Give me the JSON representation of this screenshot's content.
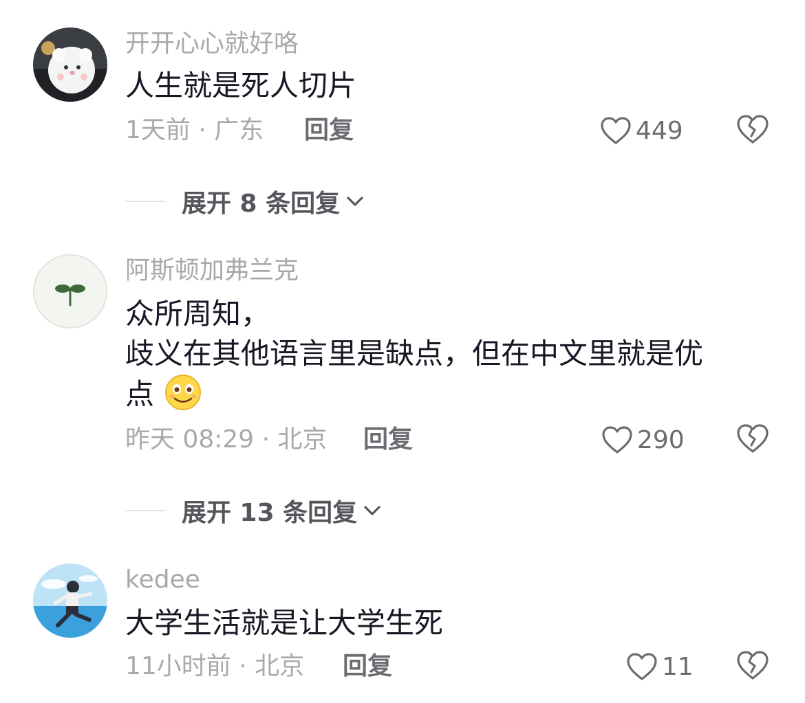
{
  "colors": {
    "secondary_text": "#a8a9ad",
    "primary_text": "#161823",
    "action_text": "#6b6c72",
    "divider": "#e3e3e5"
  },
  "comments": [
    {
      "username": "开开心心就好咯",
      "lines": [
        "人生就是死人切片"
      ],
      "meta": "1天前 · 广东",
      "reply_label": "回复",
      "likes": "449",
      "expand_label": "展开 8 条回复",
      "avatar_icon": "white-fluffy-cat-avatar"
    },
    {
      "username": "阿斯顿加弗兰克",
      "lines": [
        "众所周知，",
        "歧义在其他语言里是缺点，但在中文里就是优",
        "点"
      ],
      "emoji_icon": "smiling-face-emoji",
      "meta": "昨天 08:29 · 北京",
      "reply_label": "回复",
      "likes": "290",
      "expand_label": "展开 13 条回复",
      "avatar_icon": "green-sprout-avatar"
    },
    {
      "username": "kedee",
      "lines": [
        "大学生活就是让大学生死"
      ],
      "meta": "11小时前 · 北京",
      "reply_label": "回复",
      "likes": "11",
      "avatar_icon": "anime-runner-sky-avatar"
    }
  ],
  "icons": {
    "like": "heart-outline-icon",
    "dislike": "broken-heart-icon",
    "expand": "chevron-down-icon"
  }
}
